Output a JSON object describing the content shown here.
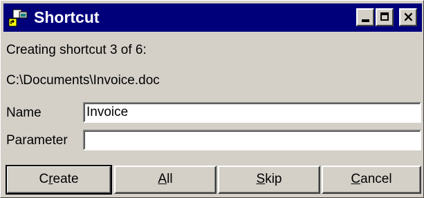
{
  "window": {
    "title": "Shortcut",
    "icon": "shortcut-app-icon"
  },
  "titlebar_buttons": {
    "minimize_icon": "minimize-icon",
    "maximize_icon": "maximize-icon",
    "close_icon": "close-icon"
  },
  "status": {
    "progress_text": "Creating shortcut 3 of 6:",
    "current_file": "C:\\Documents\\Invoice.doc"
  },
  "form": {
    "name_label": "Name",
    "name_value": "Invoice",
    "parameter_label": "Parameter",
    "parameter_value": ""
  },
  "buttons": {
    "create": {
      "mnemonic": "r",
      "prefix": "C",
      "suffix": "eate"
    },
    "all": {
      "mnemonic": "A",
      "prefix": "",
      "suffix": "ll"
    },
    "skip": {
      "mnemonic": "S",
      "prefix": "",
      "suffix": "kip"
    },
    "cancel": {
      "mnemonic": "C",
      "prefix": "",
      "suffix": "ancel"
    }
  },
  "colors": {
    "titlebar": "#00007b",
    "face": "#d4d0c8"
  }
}
